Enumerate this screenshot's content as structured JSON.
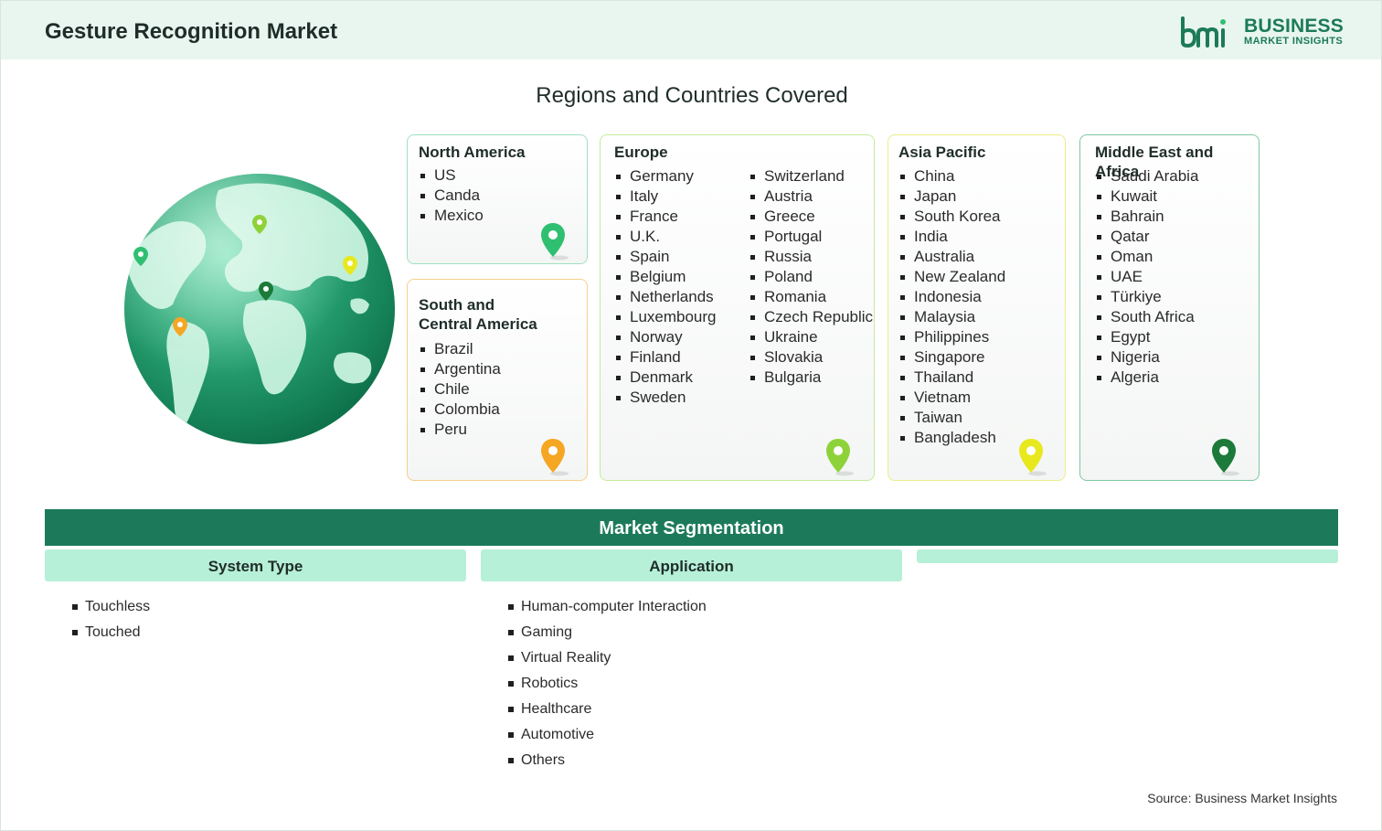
{
  "header": {
    "title": "Gesture Recognition Market",
    "logo_line1": "BUSINESS",
    "logo_line2": "MARKET INSIGHTS"
  },
  "regions_title": "Regions and Countries Covered",
  "regions": {
    "north_america": {
      "title": "North America",
      "countries": [
        "US",
        "Canda",
        "Mexico"
      ],
      "pin_color": "#2fbf71"
    },
    "south_central_america": {
      "title_line1": "South and",
      "title_line2": "Central America",
      "countries": [
        "Brazil",
        "Argentina",
        "Chile",
        "Colombia",
        "Peru"
      ],
      "pin_color": "#f5a623"
    },
    "europe": {
      "title": "Europe",
      "countries_col1": [
        "Germany",
        "Italy",
        "France",
        "U.K.",
        "Spain",
        "Belgium",
        "Netherlands",
        "Luxembourg",
        "Norway",
        "Finland",
        "Denmark",
        "Sweden"
      ],
      "countries_col2": [
        "Switzerland",
        "Austria",
        "Greece",
        "Portugal",
        "Russia",
        "Poland",
        "Romania",
        "Czech Republic",
        "Ukraine",
        "Slovakia",
        "Bulgaria"
      ],
      "pin_color": "#8ed23a"
    },
    "asia_pacific": {
      "title": "Asia Pacific",
      "countries": [
        "China",
        "Japan",
        "South Korea",
        "India",
        "Australia",
        "New Zealand",
        "Indonesia",
        "Malaysia",
        "Philippines",
        "Singapore",
        "Thailand",
        "Vietnam",
        "Taiwan",
        "Bangladesh"
      ],
      "pin_color": "#e8e81e"
    },
    "mea": {
      "title": "Middle East and Africa",
      "countries": [
        "Saudi Arabia",
        "Kuwait",
        "Bahrain",
        "Qatar",
        "Oman",
        "UAE",
        "Türkiye",
        "South Africa",
        "Egypt",
        "Nigeria",
        "Algeria"
      ],
      "pin_color": "#1c7a3a"
    }
  },
  "segmentation": {
    "title": "Market Segmentation",
    "system_type": {
      "label": "System Type",
      "items": [
        "Touchless",
        "Touched"
      ]
    },
    "application": {
      "label": "Application",
      "items": [
        "Human-computer Interaction",
        "Gaming",
        "Virtual Reality",
        "Robotics",
        "Healthcare",
        "Automotive",
        "Others"
      ]
    },
    "third_label": ""
  },
  "source": "Source: Business Market Insights",
  "colors": {
    "brand": "#1c7a5a",
    "header_bg": "#e8f6ef",
    "segment_head_bg": "#b7f0d8"
  }
}
